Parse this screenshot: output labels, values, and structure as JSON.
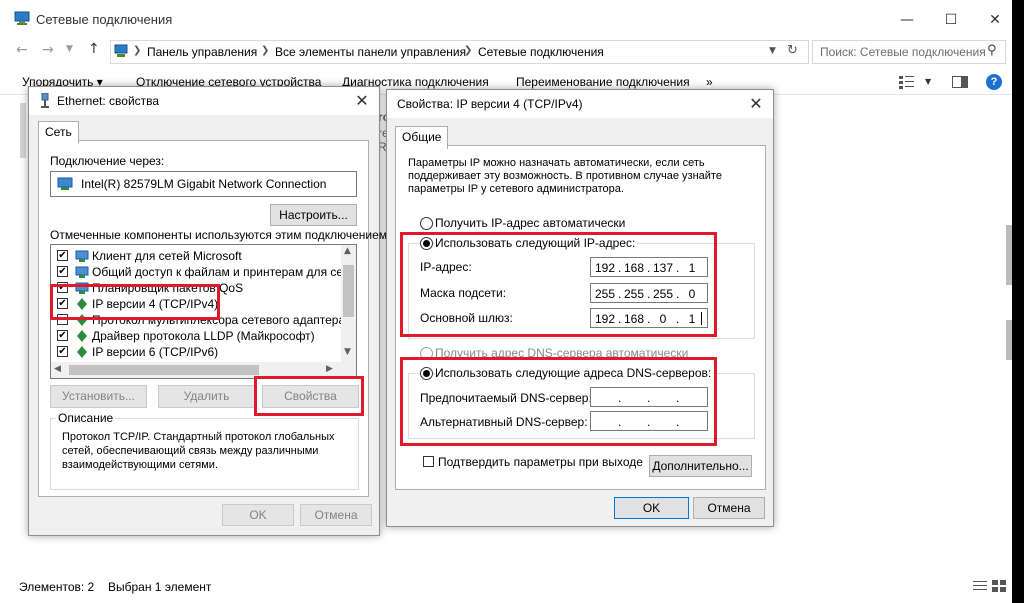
{
  "explorer": {
    "title": "Сетевые подключения",
    "breadcrumb": [
      "Панель управления",
      "Все элементы панели управления",
      "Сетевые подключения"
    ],
    "search_placeholder": "Поиск: Сетевые подключения",
    "toolbar": [
      "Упорядочить ▾",
      "Отключение сетевого устройства",
      "Диагностика подключения",
      "Переименование подключения",
      "»"
    ],
    "status_count": "Элементов: 2",
    "status_selected": "Выбран 1 элемент",
    "bg_fragments": [
      "ro",
      "re",
      "R"
    ]
  },
  "ethernet_dialog": {
    "title": "Ethernet: свойства",
    "tab": "Сеть",
    "connect_via_label": "Подключение через:",
    "adapter": "Intel(R) 82579LM Gigabit Network Connection",
    "configure_button": "Настроить...",
    "components_label": "Отмеченные компоненты используются этим подключением:",
    "components": [
      "Клиент для сетей Microsoft",
      "Общий доступ к файлам и принтерам для сетей Mi",
      "Планировщик пакетов QoS",
      "IP версии 4 (TCP/IPv4)",
      "Протокол мультиплексора сетевого адаптера (Ma",
      "Драйвер протокола LLDP (Майкрософт)",
      "IP версии 6 (TCP/IPv6)"
    ],
    "install_button": "Установить...",
    "remove_button": "Удалить",
    "properties_button": "Свойства",
    "description_label": "Описание",
    "description_text": "Протокол TCP/IP. Стандартный протокол глобальных сетей, обеспечивающий связь между различными взаимодействующими сетями.",
    "ok_button": "OK",
    "cancel_button": "Отмена"
  },
  "ipv4_dialog": {
    "title": "Свойства: IP версии 4 (TCP/IPv4)",
    "tab": "Общие",
    "intro": "Параметры IP можно назначать автоматически, если сеть поддерживает эту возможность. В противном случае узнайте параметры IP у сетевого администратора.",
    "auto_ip_label": "Получить IP-адрес автоматически",
    "manual_ip_label": "Использовать следующий IP-адрес:",
    "ip_label": "IP-адрес:",
    "ip_value": [
      "192",
      "168",
      "137",
      "1"
    ],
    "mask_label": "Маска подсети:",
    "mask_value": [
      "255",
      "255",
      "255",
      "0"
    ],
    "gateway_label": "Основной шлюз:",
    "gateway_value": [
      "192",
      "168",
      "0",
      "1"
    ],
    "auto_dns_label": "Получить адрес DNS-сервера автоматически",
    "manual_dns_label": "Использовать следующие адреса DNS-серверов:",
    "preferred_dns_label": "Предпочитаемый DNS-сервер:",
    "alternate_dns_label": "Альтернативный DNS-сервер:",
    "validate_label": "Подтвердить параметры при выходе",
    "advanced_button": "Дополнительно...",
    "ok_button": "OK",
    "cancel_button": "Отмена"
  },
  "colors": {
    "highlight": "#e0192d",
    "accent": "#0078d7",
    "dialog_bg": "#f0f0f0"
  }
}
